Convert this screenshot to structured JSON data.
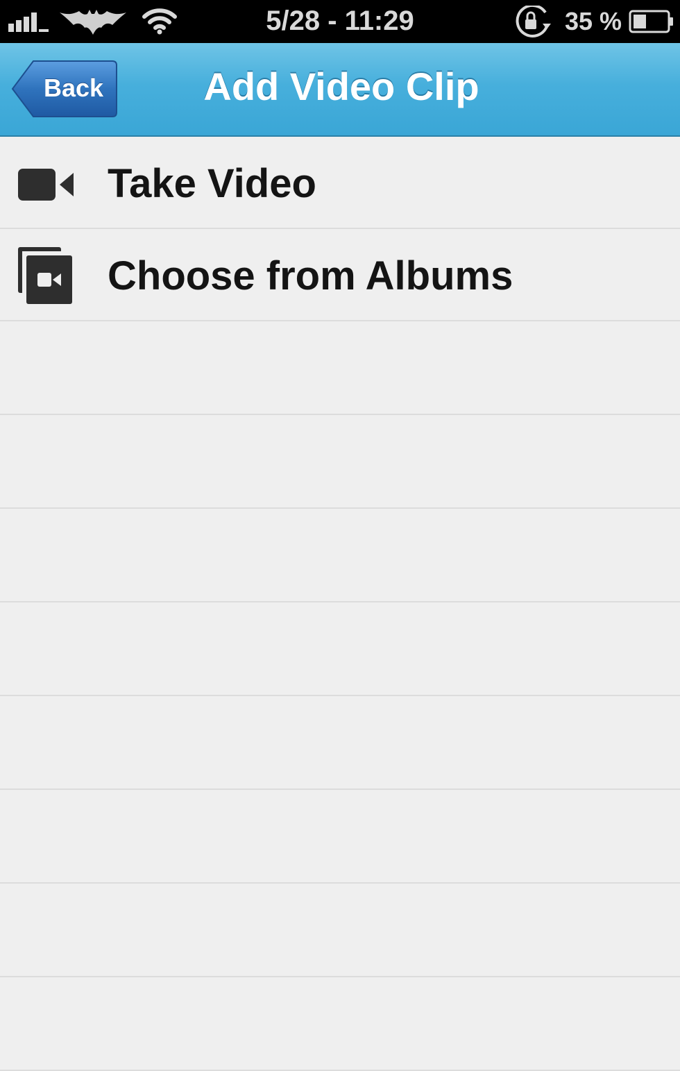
{
  "status_bar": {
    "time": "5/28 - 11:29",
    "battery_percent": "35 %",
    "icons": [
      "signal-bars-icon",
      "carrier-bat-logo-icon",
      "wifi-icon",
      "orientation-lock-icon",
      "battery-icon"
    ]
  },
  "nav": {
    "title": "Add Video Clip",
    "back_label": "Back",
    "colors": {
      "nav_bar": "#47afdc",
      "back_button": "#2f73bd"
    }
  },
  "list": {
    "items": [
      {
        "label": "Take Video",
        "icon": "video-camera-icon"
      },
      {
        "label": "Choose from Albums",
        "icon": "video-album-icon"
      }
    ]
  }
}
